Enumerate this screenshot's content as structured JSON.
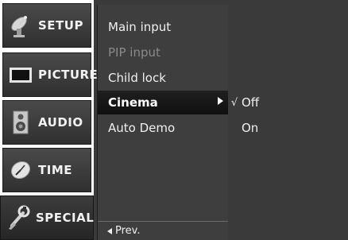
{
  "tabs": [
    {
      "label": "SETUP",
      "icon": "satellite-dish-icon"
    },
    {
      "label": "PICTURE",
      "icon": "tv-screen-icon"
    },
    {
      "label": "AUDIO",
      "icon": "speaker-icon"
    },
    {
      "label": "TIME",
      "icon": "clock-icon"
    },
    {
      "label": "SPECIAL",
      "icon": "wrench-icon",
      "active": true
    }
  ],
  "submenu": {
    "items": [
      {
        "label": "Main input",
        "state": "normal"
      },
      {
        "label": "PIP input",
        "state": "disabled"
      },
      {
        "label": "Child lock",
        "state": "normal"
      },
      {
        "label": "Cinema",
        "state": "selected"
      },
      {
        "label": "Auto Demo",
        "state": "normal"
      }
    ],
    "prev_label": "Prev."
  },
  "options": {
    "items": [
      {
        "label": "Off",
        "checked": true,
        "check_glyph": "√"
      },
      {
        "label": "On",
        "checked": false
      }
    ]
  },
  "colors": {
    "background": "#3a3a3a",
    "highlight": "#101010",
    "text": "#f0f0f0",
    "disabled_text": "#8a8a8a"
  }
}
